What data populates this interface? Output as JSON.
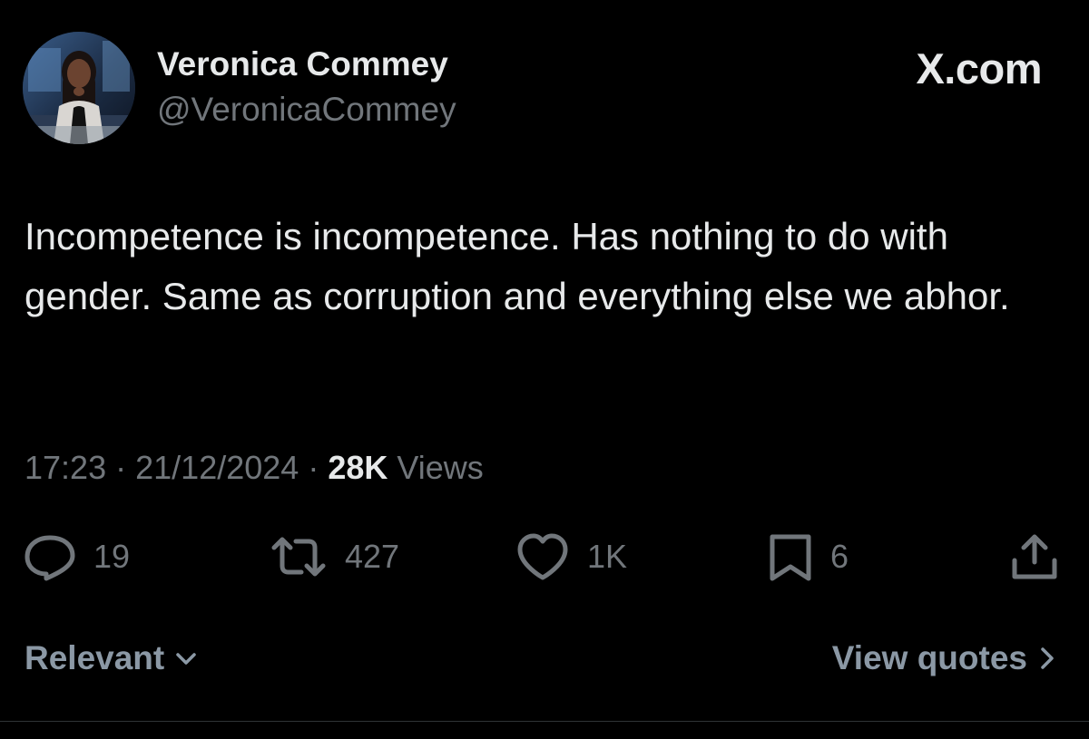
{
  "author": {
    "name": "Veronica Commey",
    "handle": "@VeronicaCommey"
  },
  "site_label": "X.com",
  "tweet": {
    "text": "Incompetence is incompetence. Has nothing to do with gender. Same as corruption and everything else we abhor.",
    "time": "17:23",
    "separator": "·",
    "date": "21/12/2024",
    "views_count": "28K",
    "views_label": "Views"
  },
  "actions": {
    "replies": {
      "icon": "reply-icon",
      "count": "19"
    },
    "reposts": {
      "icon": "repost-icon",
      "count": "427"
    },
    "likes": {
      "icon": "heart-icon",
      "count": "1K"
    },
    "bookmarks": {
      "icon": "bookmark-icon",
      "count": "6"
    },
    "share": {
      "icon": "share-icon"
    }
  },
  "footer": {
    "sort_label": "Relevant",
    "view_quotes_label": "View quotes"
  },
  "colors": {
    "background": "#000000",
    "primary_text": "#e7e9ea",
    "secondary_text": "#71767b",
    "footer_text": "#8b98a5"
  }
}
